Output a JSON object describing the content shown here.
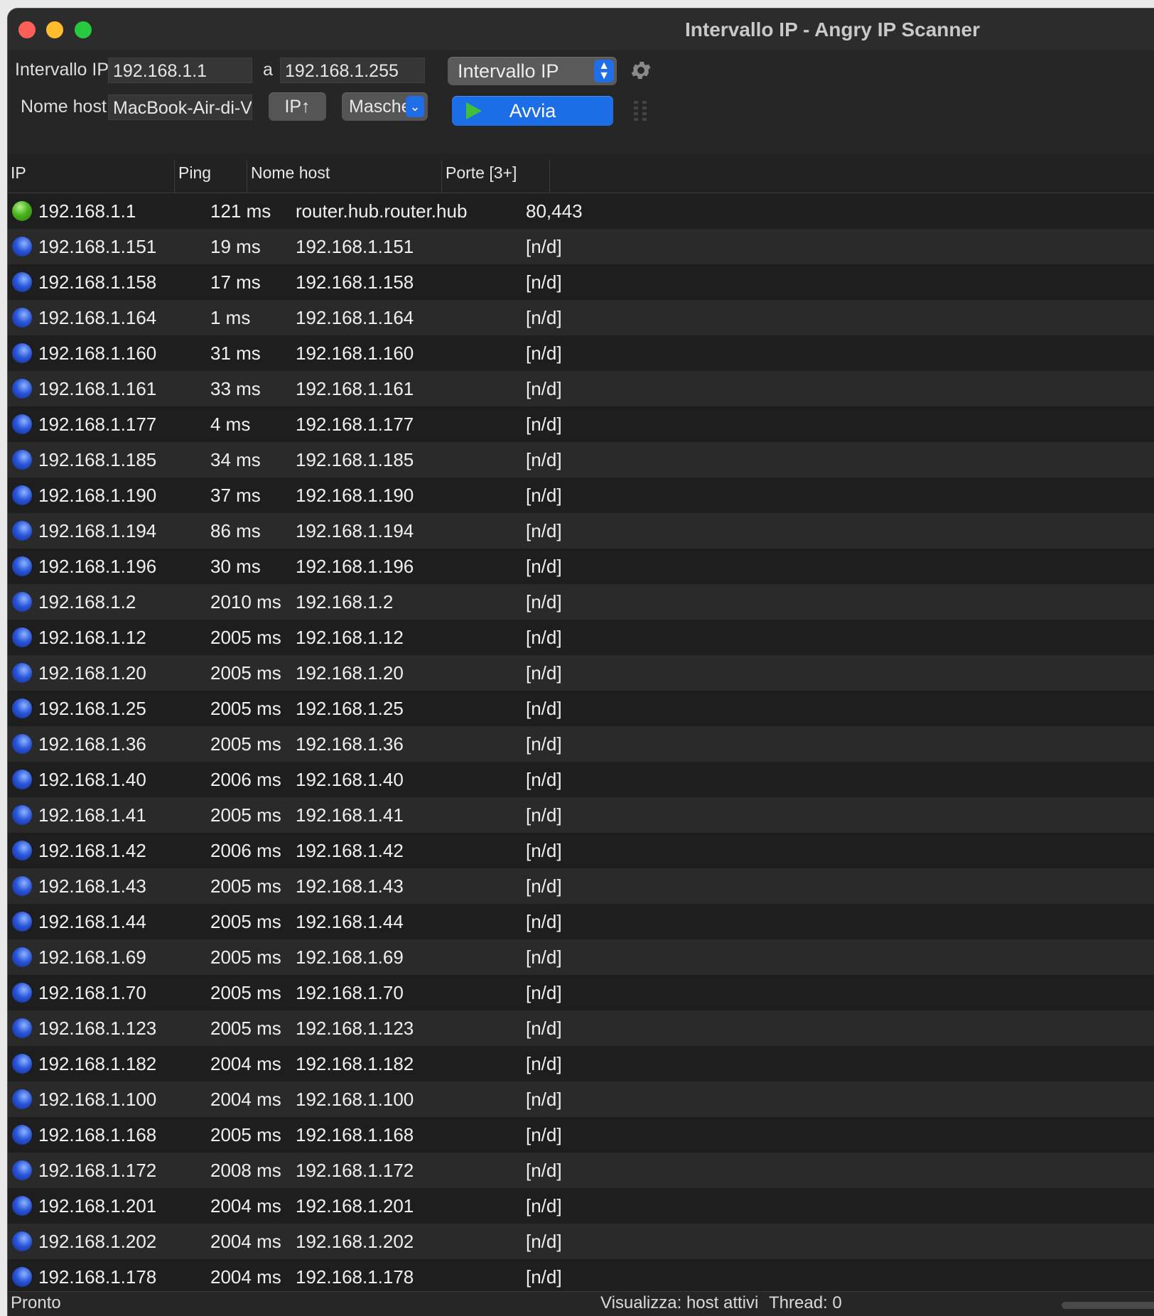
{
  "window": {
    "title": "Intervallo IP - Angry IP Scanner"
  },
  "toolbar": {
    "range_label": "Intervallo IP:",
    "range_start": "192.168.1.1",
    "range_to_label": "a",
    "range_end": "192.168.1.255",
    "feeder_select": "Intervallo IP",
    "hostname_label": "Nome host:",
    "hostname_value": "MacBook-Air-di-Vito",
    "ip_up_button": "IP↑",
    "netmask_button": "Masche",
    "start_button": "Avvia"
  },
  "table": {
    "columns": [
      "IP",
      "Ping",
      "Nome host",
      "Porte [3+]"
    ],
    "rows": [
      {
        "status": "alive",
        "ip": "192.168.1.1",
        "ping": "121 ms",
        "host": "router.hub.router.hub",
        "ports": "80,443"
      },
      {
        "status": "dead",
        "ip": "192.168.1.151",
        "ping": "19 ms",
        "host": "192.168.1.151",
        "ports": "[n/d]"
      },
      {
        "status": "dead",
        "ip": "192.168.1.158",
        "ping": "17 ms",
        "host": "192.168.1.158",
        "ports": "[n/d]"
      },
      {
        "status": "dead",
        "ip": "192.168.1.164",
        "ping": "1 ms",
        "host": "192.168.1.164",
        "ports": "[n/d]"
      },
      {
        "status": "dead",
        "ip": "192.168.1.160",
        "ping": "31 ms",
        "host": "192.168.1.160",
        "ports": "[n/d]"
      },
      {
        "status": "dead",
        "ip": "192.168.1.161",
        "ping": "33 ms",
        "host": "192.168.1.161",
        "ports": "[n/d]"
      },
      {
        "status": "dead",
        "ip": "192.168.1.177",
        "ping": "4 ms",
        "host": "192.168.1.177",
        "ports": "[n/d]"
      },
      {
        "status": "dead",
        "ip": "192.168.1.185",
        "ping": "34 ms",
        "host": "192.168.1.185",
        "ports": "[n/d]"
      },
      {
        "status": "dead",
        "ip": "192.168.1.190",
        "ping": "37 ms",
        "host": "192.168.1.190",
        "ports": "[n/d]"
      },
      {
        "status": "dead",
        "ip": "192.168.1.194",
        "ping": "86 ms",
        "host": "192.168.1.194",
        "ports": "[n/d]"
      },
      {
        "status": "dead",
        "ip": "192.168.1.196",
        "ping": "30 ms",
        "host": "192.168.1.196",
        "ports": "[n/d]"
      },
      {
        "status": "dead",
        "ip": "192.168.1.2",
        "ping": "2010 ms",
        "host": "192.168.1.2",
        "ports": "[n/d]"
      },
      {
        "status": "dead",
        "ip": "192.168.1.12",
        "ping": "2005 ms",
        "host": "192.168.1.12",
        "ports": "[n/d]"
      },
      {
        "status": "dead",
        "ip": "192.168.1.20",
        "ping": "2005 ms",
        "host": "192.168.1.20",
        "ports": "[n/d]"
      },
      {
        "status": "dead",
        "ip": "192.168.1.25",
        "ping": "2005 ms",
        "host": "192.168.1.25",
        "ports": "[n/d]"
      },
      {
        "status": "dead",
        "ip": "192.168.1.36",
        "ping": "2005 ms",
        "host": "192.168.1.36",
        "ports": "[n/d]"
      },
      {
        "status": "dead",
        "ip": "192.168.1.40",
        "ping": "2006 ms",
        "host": "192.168.1.40",
        "ports": "[n/d]"
      },
      {
        "status": "dead",
        "ip": "192.168.1.41",
        "ping": "2005 ms",
        "host": "192.168.1.41",
        "ports": "[n/d]"
      },
      {
        "status": "dead",
        "ip": "192.168.1.42",
        "ping": "2006 ms",
        "host": "192.168.1.42",
        "ports": "[n/d]"
      },
      {
        "status": "dead",
        "ip": "192.168.1.43",
        "ping": "2005 ms",
        "host": "192.168.1.43",
        "ports": "[n/d]"
      },
      {
        "status": "dead",
        "ip": "192.168.1.44",
        "ping": "2005 ms",
        "host": "192.168.1.44",
        "ports": "[n/d]"
      },
      {
        "status": "dead",
        "ip": "192.168.1.69",
        "ping": "2005 ms",
        "host": "192.168.1.69",
        "ports": "[n/d]"
      },
      {
        "status": "dead",
        "ip": "192.168.1.70",
        "ping": "2005 ms",
        "host": "192.168.1.70",
        "ports": "[n/d]"
      },
      {
        "status": "dead",
        "ip": "192.168.1.123",
        "ping": "2005 ms",
        "host": "192.168.1.123",
        "ports": "[n/d]"
      },
      {
        "status": "dead",
        "ip": "192.168.1.182",
        "ping": "2004 ms",
        "host": "192.168.1.182",
        "ports": "[n/d]"
      },
      {
        "status": "dead",
        "ip": "192.168.1.100",
        "ping": "2004 ms",
        "host": "192.168.1.100",
        "ports": "[n/d]"
      },
      {
        "status": "dead",
        "ip": "192.168.1.168",
        "ping": "2005 ms",
        "host": "192.168.1.168",
        "ports": "[n/d]"
      },
      {
        "status": "dead",
        "ip": "192.168.1.172",
        "ping": "2008 ms",
        "host": "192.168.1.172",
        "ports": "[n/d]"
      },
      {
        "status": "dead",
        "ip": "192.168.1.201",
        "ping": "2004 ms",
        "host": "192.168.1.201",
        "ports": "[n/d]"
      },
      {
        "status": "dead",
        "ip": "192.168.1.202",
        "ping": "2004 ms",
        "host": "192.168.1.202",
        "ports": "[n/d]"
      },
      {
        "status": "dead",
        "ip": "192.168.1.178",
        "ping": "2004 ms",
        "host": "192.168.1.178",
        "ports": "[n/d]"
      }
    ]
  },
  "statusbar": {
    "state": "Pronto",
    "display": "Visualizza: host attivi",
    "threads": "Thread: 0"
  },
  "colors": {
    "window_bg": "#2a2a2a",
    "accent": "#1c6ee6",
    "alive": "#49b41e",
    "dead": "#2a55d8"
  },
  "icons": {
    "settings": "gear-icon",
    "start": "play-icon",
    "alive_status": "green-dot-icon",
    "dead_status": "blue-dot-icon",
    "resize": "grip-icon"
  }
}
